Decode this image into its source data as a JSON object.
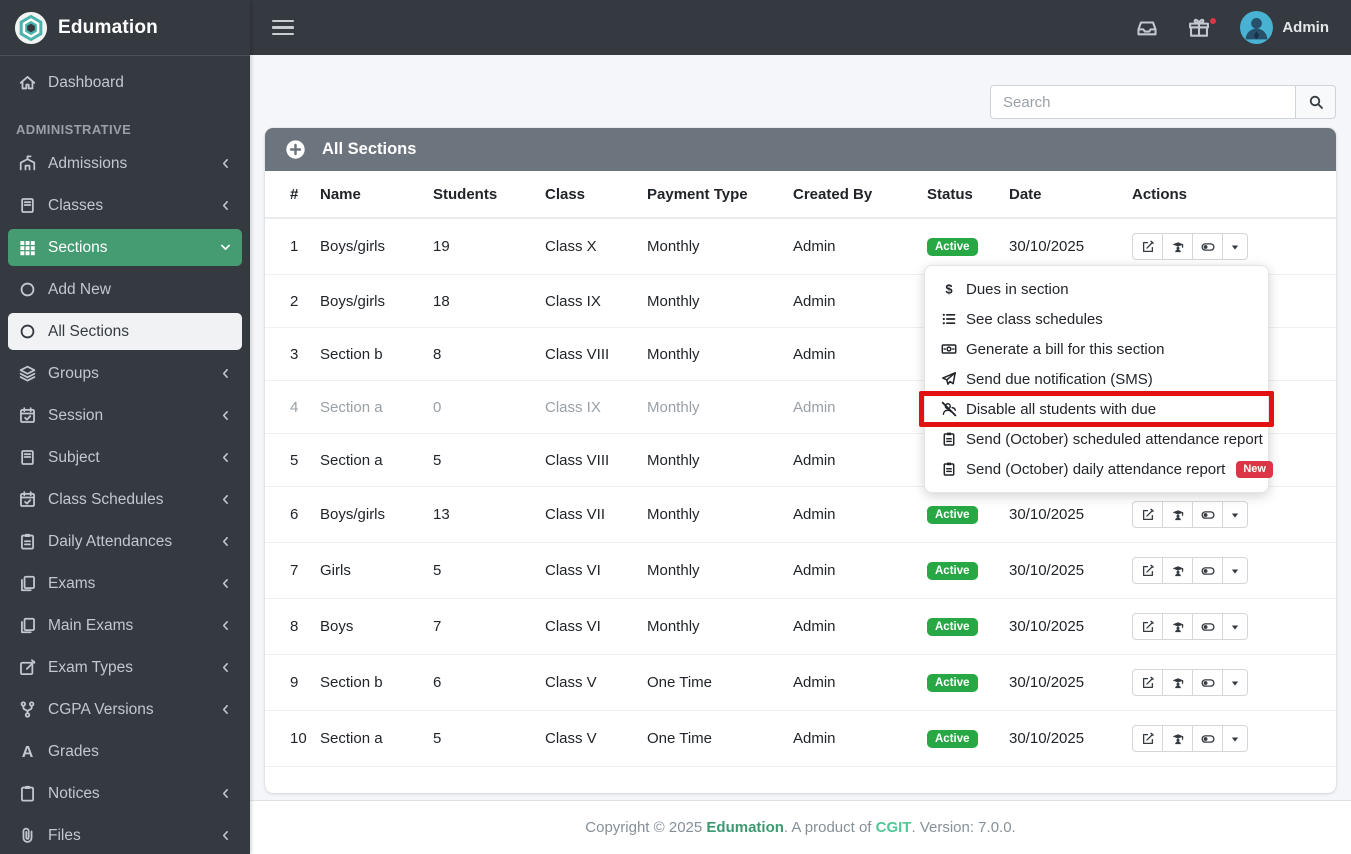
{
  "colors": {
    "sidebar-bg": "#343a40",
    "accent-green": "#459b72",
    "badge-green": "#28a745",
    "panel-gray": "#6c757d",
    "content-bg": "#f4f6f9",
    "danger-red": "#dc3545",
    "highlight-red": "#e31212",
    "footer-brand": "#3d9970",
    "footer-company": "#52c796"
  },
  "brand": {
    "name": "Edumation",
    "logo_icon": "hex-logo"
  },
  "navbar": {
    "user": "Admin",
    "icons": [
      {
        "icon": "inbox",
        "name": "inbox-icon",
        "dot": false
      },
      {
        "icon": "gift",
        "name": "gift-icon",
        "dot": true
      }
    ]
  },
  "search": {
    "placeholder": "Search"
  },
  "sidebar": {
    "top_items": [
      {
        "label": "Dashboard",
        "icon": "home",
        "chevron": ""
      }
    ],
    "section_label": "ADMINISTRATIVE",
    "items": [
      {
        "label": "Admissions",
        "icon": "school",
        "chevron": "chevron-left"
      },
      {
        "label": "Classes",
        "icon": "book",
        "chevron": "chevron-left"
      },
      {
        "label": "Sections",
        "icon": "th",
        "chevron": "chevron-down",
        "active": true
      },
      {
        "label": "Add New",
        "icon": "circle",
        "chevron": "",
        "sub": true
      },
      {
        "label": "All Sections",
        "icon": "circle",
        "chevron": "",
        "sub": true,
        "selected": true
      },
      {
        "label": "Groups",
        "icon": "layers",
        "chevron": "chevron-left"
      },
      {
        "label": "Session",
        "icon": "calendar",
        "chevron": "chevron-left"
      },
      {
        "label": "Subject",
        "icon": "book",
        "chevron": "chevron-left"
      },
      {
        "label": "Class Schedules",
        "icon": "calendar",
        "chevron": "chevron-left"
      },
      {
        "label": "Daily Attendances",
        "icon": "clipboard-list",
        "chevron": "chevron-left"
      },
      {
        "label": "Exams",
        "icon": "copy",
        "chevron": "chevron-left"
      },
      {
        "label": "Main Exams",
        "icon": "copy",
        "chevron": "chevron-left"
      },
      {
        "label": "Exam Types",
        "icon": "pen-square",
        "chevron": "chevron-left"
      },
      {
        "label": "CGPA Versions",
        "icon": "code-branch",
        "chevron": "chevron-left"
      },
      {
        "label": "Grades",
        "icon": "font-a",
        "chevron": ""
      },
      {
        "label": "Notices",
        "icon": "clipboard",
        "chevron": "chevron-left"
      },
      {
        "label": "Files",
        "icon": "paperclip",
        "chevron": "chevron-left"
      }
    ]
  },
  "panel": {
    "title": "All Sections"
  },
  "table": {
    "headers": [
      "#",
      "Name",
      "Students",
      "Class",
      "Payment Type",
      "Created By",
      "Status",
      "Date",
      "Actions"
    ],
    "rows": [
      {
        "num": "1",
        "name": "Boys/girls",
        "students": "19",
        "klass": "Class X",
        "payment": "Monthly",
        "created": "Admin",
        "status": "Active",
        "date": "30/10/2025",
        "actions": true,
        "muted": false
      },
      {
        "num": "2",
        "name": "Boys/girls",
        "students": "18",
        "klass": "Class IX",
        "payment": "Monthly",
        "created": "Admin",
        "status": "",
        "date": "",
        "actions": false,
        "muted": false
      },
      {
        "num": "3",
        "name": "Section b",
        "students": "8",
        "klass": "Class VIII",
        "payment": "Monthly",
        "created": "Admin",
        "status": "",
        "date": "",
        "actions": false,
        "muted": false
      },
      {
        "num": "4",
        "name": "Section a",
        "students": "0",
        "klass": "Class IX",
        "payment": "Monthly",
        "created": "Admin",
        "status": "",
        "date": "",
        "actions": false,
        "muted": true
      },
      {
        "num": "5",
        "name": "Section a",
        "students": "5",
        "klass": "Class VIII",
        "payment": "Monthly",
        "created": "Admin",
        "status": "",
        "date": "",
        "actions": false,
        "muted": false
      },
      {
        "num": "6",
        "name": "Boys/girls",
        "students": "13",
        "klass": "Class VII",
        "payment": "Monthly",
        "created": "Admin",
        "status": "Active",
        "date": "30/10/2025",
        "actions": true,
        "muted": false
      },
      {
        "num": "7",
        "name": "Girls",
        "students": "5",
        "klass": "Class VI",
        "payment": "Monthly",
        "created": "Admin",
        "status": "Active",
        "date": "30/10/2025",
        "actions": true,
        "muted": false
      },
      {
        "num": "8",
        "name": "Boys",
        "students": "7",
        "klass": "Class VI",
        "payment": "Monthly",
        "created": "Admin",
        "status": "Active",
        "date": "30/10/2025",
        "actions": true,
        "muted": false
      },
      {
        "num": "9",
        "name": "Section b",
        "students": "6",
        "klass": "Class V",
        "payment": "One Time",
        "created": "Admin",
        "status": "Active",
        "date": "30/10/2025",
        "actions": true,
        "muted": false
      },
      {
        "num": "10",
        "name": "Section a",
        "students": "5",
        "klass": "Class V",
        "payment": "One Time",
        "created": "Admin",
        "status": "Active",
        "date": "30/10/2025",
        "actions": true,
        "muted": false
      }
    ]
  },
  "row_actions": [
    {
      "icon": "edit",
      "name": "edit-section-button"
    },
    {
      "icon": "student",
      "name": "students-button"
    },
    {
      "icon": "toggle",
      "name": "toggle-status-button"
    },
    {
      "icon": "caret-down",
      "name": "more-actions-button"
    }
  ],
  "context_menu": {
    "items": [
      {
        "icon": "dollar",
        "label": "Dues in section",
        "highlighted": false,
        "badge": ""
      },
      {
        "icon": "list",
        "label": "See class schedules",
        "highlighted": false,
        "badge": ""
      },
      {
        "icon": "money-bill",
        "label": "Generate a bill for this section",
        "highlighted": false,
        "badge": ""
      },
      {
        "icon": "paper-plane",
        "label": "Send due notification (SMS)",
        "highlighted": false,
        "badge": ""
      },
      {
        "icon": "users-slash",
        "label": "Disable all students with due",
        "highlighted": true,
        "badge": ""
      },
      {
        "icon": "clipboard-list",
        "label": "Send (October) scheduled attendance report",
        "highlighted": false,
        "badge": ""
      },
      {
        "icon": "clipboard-list",
        "label": "Send (October) daily attendance report",
        "highlighted": false,
        "badge": "New"
      }
    ]
  },
  "footer": {
    "part1": "Copyright © 2025 ",
    "brand": "Edumation",
    "part2": ". A product of ",
    "company": "CGIT",
    "part3": ". Version: 7.0.0."
  }
}
